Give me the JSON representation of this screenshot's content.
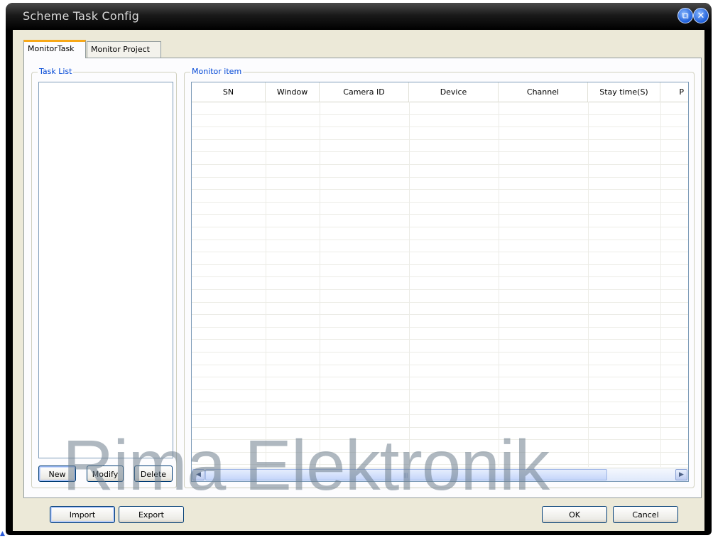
{
  "window": {
    "title": "Scheme Task Config",
    "restore_glyph": "⧉",
    "close_glyph": "✕"
  },
  "tabs": [
    {
      "label": "MonitorTask",
      "active": true
    },
    {
      "label": "Monitor Project",
      "active": false
    }
  ],
  "task_list": {
    "legend": "Task List",
    "items": [],
    "buttons": {
      "new": "New",
      "modify": "Modify",
      "delete": "Delete"
    }
  },
  "monitor_item": {
    "legend": "Monitor item",
    "columns": [
      "SN",
      "Window",
      "Camera ID",
      "Device",
      "Channel",
      "Stay time(S)",
      "P"
    ],
    "rows": [],
    "scroll_left_glyph": "◀",
    "scroll_right_glyph": "▶"
  },
  "footer": {
    "import": "Import",
    "export": "Export",
    "ok": "OK",
    "cancel": "Cancel"
  },
  "watermark": "Rima Elektronik",
  "colors": {
    "accent_tab": "#f7a818",
    "legend_text": "#0046d5",
    "dialog_bg": "#ece9d8"
  }
}
